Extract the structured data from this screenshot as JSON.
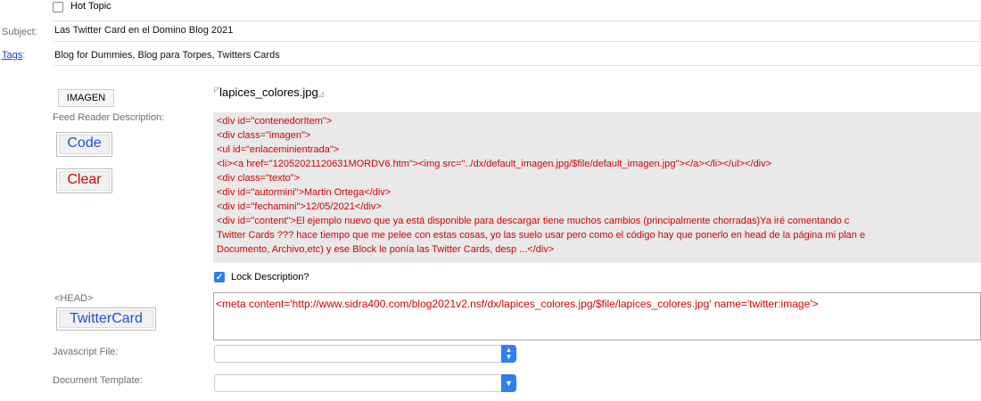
{
  "hot_topic": {
    "label": "Hot Topic",
    "checked": false
  },
  "subject": {
    "label": "Subject:",
    "value": "Las Twitter Card en el Domino Blog 2021"
  },
  "tags": {
    "label": "Tags",
    "suffix": ":",
    "value": "Blog for Dummies, Blog para Torpes, Twitters Cards"
  },
  "image": {
    "button_label": "IMAGEN",
    "filename": "lapices_colores.jpg"
  },
  "feed_reader": {
    "label": "Feed Reader Description:",
    "code_button": "Code",
    "clear_button": "Clear",
    "html_lines": [
      "<div id=\"contenedorItem\">",
      " <div class=\"imagen\">",
      " <ul id=\"enlaceminientrada\">",
      " <li><a href=\"12052021120631MORDV6.htm\"><img src=\"../dx/default_imagen.jpg/$file/default_imagen.jpg\"></a></li></ul></div>",
      " <div class=\"texto\">",
      " <div id=\"autormini\">Martin Ortega</div>",
      " <div id=\"fechamini\">12/05/2021</div>",
      " <div id=\"content\">El ejemplo nuevo que ya está disponible para descargar tiene muchos cambios (principalmente chorradas)Ya iré comentando c",
      "Twitter Cards ??? hace tiempo que me pelee con estas cosas, yo las suelo usar pero como el código hay que ponerlo en head de la página mi plan e",
      "Documento, Archivo,etc) y ese Block le ponía las Twitter Cards, desp ...</div>"
    ]
  },
  "lock_description": {
    "label": "Lock Description?",
    "checked": true
  },
  "head": {
    "label": "<HEAD>",
    "twitter_button": "TwitterCard",
    "meta_value": "<meta content='http://www.sidra400.com/blog2021v2.nsf/dx/lapices_colores.jpg/$file/lapices_colores.jpg' name='twitter:image'>"
  },
  "javascript_file": {
    "label": "Javascript File:",
    "value": ""
  },
  "document_template": {
    "label": "Document Template:",
    "value": ""
  },
  "colors": {
    "accent": "#2f7ff0",
    "code_red": "#d40000",
    "link_blue": "#1f3fbf"
  }
}
